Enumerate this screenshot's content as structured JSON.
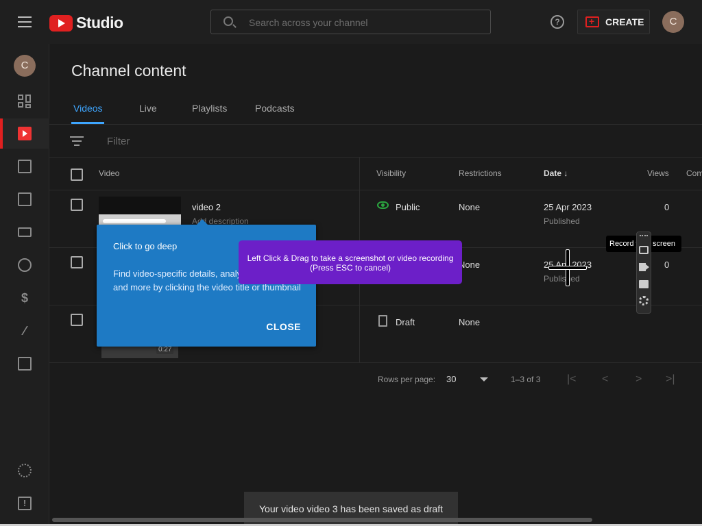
{
  "header": {
    "logo_text": "Studio",
    "search_placeholder": "Search across your channel",
    "create_label": "CREATE",
    "avatar_letter": "C"
  },
  "sidebar": {
    "avatar_letter": "C",
    "items": [
      {
        "icon": "dashboard-icon",
        "active": false
      },
      {
        "icon": "content-icon",
        "active": true
      },
      {
        "icon": "analytics-icon",
        "active": false
      },
      {
        "icon": "comments-icon",
        "active": false
      },
      {
        "icon": "subtitles-icon",
        "active": false
      },
      {
        "icon": "copyright-icon",
        "active": false
      },
      {
        "icon": "earn-icon",
        "active": false
      },
      {
        "icon": "customization-icon",
        "active": false
      },
      {
        "icon": "audio-library-icon",
        "active": false
      },
      {
        "icon": "settings-icon",
        "active": false
      },
      {
        "icon": "feedback-icon",
        "active": false
      }
    ]
  },
  "page": {
    "title": "Channel content",
    "tabs": [
      "Videos",
      "Live",
      "Playlists",
      "Podcasts"
    ],
    "active_tab": "Videos",
    "filter_placeholder": "Filter"
  },
  "table": {
    "headers": {
      "video": "Video",
      "visibility": "Visibility",
      "restrictions": "Restrictions",
      "date": "Date",
      "views": "Views",
      "comments": "Com"
    },
    "rows": [
      {
        "title": "video 2",
        "description": "Add description",
        "visibility": "Public",
        "restrictions": "None",
        "date": "25 Apr 2023",
        "date_status": "Published",
        "views": "0"
      },
      {
        "title": "",
        "description": "",
        "visibility": "",
        "restrictions": "None",
        "date": "25 Apr 2023",
        "date_status": "Published",
        "views": "0"
      },
      {
        "title": "",
        "description": "",
        "visibility": "Draft",
        "restrictions": "None",
        "date": "",
        "date_status": "",
        "views": "",
        "duration": "0:27"
      }
    ]
  },
  "pagination": {
    "rows_per_page_label": "Rows per page:",
    "rows_per_page": "30",
    "range": "1–3 of 3",
    "first": "|<",
    "prev": "<",
    "next": ">",
    "last": ">|"
  },
  "tooltip_card": {
    "title": "Click to go deep",
    "body": "Find video-specific details, analytics, comments and more by clicking the video title or thumbnail",
    "close_label": "CLOSE"
  },
  "capture_overlay": {
    "line1": "Left Click & Drag to take a screenshot or video recording",
    "line2": "(Press ESC to cancel)",
    "record_tooltip": "Record your screen"
  },
  "snackbar": {
    "message": "Your video video 3 has been saved as draft"
  },
  "colors": {
    "brand_red": "#e02020",
    "accent_blue": "#3ea6ff",
    "card_blue": "#1e7ac4",
    "capture_purple": "#6c1fc8",
    "public_green": "#2ba640"
  }
}
